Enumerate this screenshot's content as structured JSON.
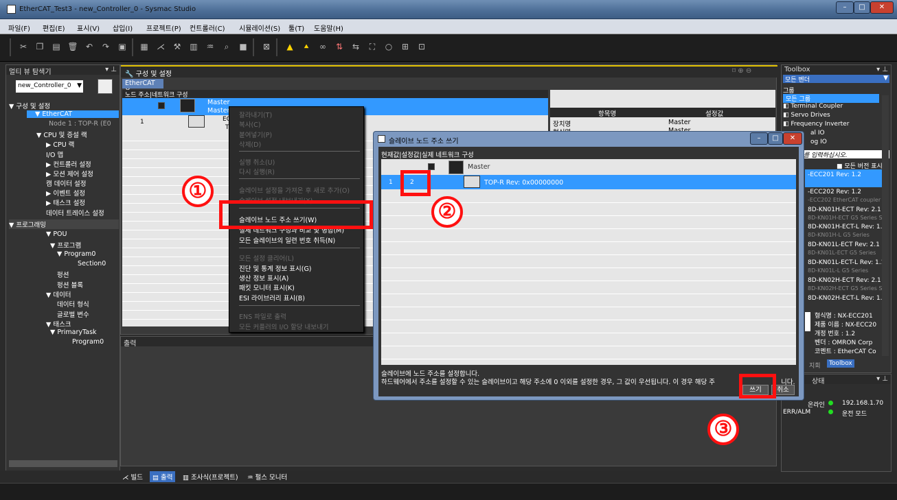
{
  "window": {
    "title": "EtherCAT_Test3 - new_Controller_0 - Sysmac Studio"
  },
  "menu": [
    "파일(F)",
    "편집(E)",
    "표시(V)",
    "삽입(I)",
    "프로젝트(P)",
    "컨트롤러(C)",
    "시뮬레이션(S)",
    "툴(T)",
    "도움말(H)"
  ],
  "multiview": {
    "title": "멀티 뷰 탐색기",
    "controller": "new_Controller_0",
    "tree": [
      "▼ 구성 및 설정",
      "▼ EtherCAT",
      "Node 1 : TOP-R (E0",
      "▼ CPU 및 증설 랙",
      "▶ CPU 랙",
      "I/O 맵",
      "▶ 컨트롤러 설정",
      "▶ 모션 제어 설정",
      "캠 데이터 설정",
      "▶ 이벤트 설정",
      "▶ 태스크 설정",
      "데이터 트레이스 설정",
      "▼ 프로그래밍",
      "▼ POU",
      "▼ 프로그램",
      "▼ Program0",
      "Section0",
      "펑션",
      "펑션 블록",
      "▼ 데이터",
      "데이터 형식",
      "글로벌 변수",
      "▼ 태스크",
      "▼ PrimaryTask",
      "Program0"
    ],
    "filter": "필터"
  },
  "config": {
    "title": "구성 및 설정",
    "tab": "EtherCAT",
    "grid_header": "노드 주소|네트워크 구성",
    "master": "Master",
    "master2": "Master",
    "node_addr": "1",
    "node_label": "EC",
    "node_label2": "T",
    "prop_headers": [
      "항목명",
      "설정값"
    ],
    "prop_rows": [
      [
        "장치명",
        "Master"
      ],
      [
        "형식명",
        "Master"
      ]
    ]
  },
  "context_menu": {
    "items": [
      {
        "label": "잘라내기(T)",
        "enabled": false
      },
      {
        "label": "복사(C)",
        "enabled": false
      },
      {
        "label": "붙여넣기(P)",
        "enabled": false
      },
      {
        "label": "삭제(D)",
        "enabled": false
      },
      {
        "label": "실행 취소(U)",
        "enabled": false
      },
      {
        "label": "다시 실행(R)",
        "enabled": false
      },
      {
        "label": "슬레이브 설정을 가져온 후 새로 추가(O)",
        "enabled": false
      },
      {
        "label": "슬레이브 설정 내보내기(X)",
        "enabled": false
      },
      {
        "label": "슬레이브 노드 주소 쓰기(W)",
        "enabled": true
      },
      {
        "label": "실제 네트워크 구성과 비교 및 병합(M)",
        "enabled": true
      },
      {
        "label": "모든 슬레이브의 일련 번호 취득(N)",
        "enabled": true
      },
      {
        "label": "모든 설정 클리어(L)",
        "enabled": false
      },
      {
        "label": "진단 및 통계 정보 표시(G)",
        "enabled": true
      },
      {
        "label": "생산 정보 표시(A)",
        "enabled": true
      },
      {
        "label": "패킷 모니터 표시(K)",
        "enabled": true
      },
      {
        "label": "ESI 라이브러리 표시(B)",
        "enabled": true
      },
      {
        "label": "ENS 파일로 출력",
        "enabled": false
      },
      {
        "label": "모든 커플러의 I/O 할당 내보내기",
        "enabled": false
      }
    ]
  },
  "dialog": {
    "title": "슬레이브 노드 주소 쓰기",
    "grid_header": "현재값|설정값|실제 네트워크 구성",
    "master": "Master",
    "row_current": "1",
    "row_set": "2",
    "node_label": "TOP-R Rev: 0x00000000",
    "msg1": "슬레이브에 노드 주소를 설정합니다.",
    "msg2": "하드웨어에서 주소를 설정할 수 있는 슬레이브이고 해당 주소에 0 이외를 설정한 경우, 그 값이 우선됩니다. 이 경우 해당 주",
    "msg2_tail": "니다.",
    "write_btn": "쓰기",
    "cancel_btn": "취소"
  },
  "output": {
    "title": "출력"
  },
  "bottom_tabs": [
    "빌드",
    "출력",
    "조사식(프로젝트)",
    "펄스 모니터"
  ],
  "toolbox": {
    "title": "Toolbox",
    "vendor": "모든 벤더",
    "group_label": "그룹",
    "groups": [
      "모든 그룹",
      "Terminal Coupler",
      "Servo Drives",
      "Frequency Inverter",
      "al IO",
      "og IO"
    ],
    "search_placeholder": "를 입력하십시오.",
    "all_versions": "■ 모든 버전 표시",
    "items": [
      {
        "name": "-ECC201 Rev: 1.2",
        "desc": ""
      },
      {
        "name": "-ECC202 Rev: 1.2",
        "desc": "-ECC202 EtherCAT coupler"
      },
      {
        "name": "8D-KN01H-ECT Rev: 2.1",
        "desc": "8D-KN01H-ECT G5 Series S"
      },
      {
        "name": "8D-KN01H-ECT-L Rev: 1.1",
        "desc": "8D-KN01H-L G5 Series"
      },
      {
        "name": "8D-KN01L-ECT Rev: 2.1",
        "desc": "8D-KN01L-ECT G5 Series"
      },
      {
        "name": "8D-KN01L-ECT-L Rev: 1.1",
        "desc": "8D-KN01L-L G5 Series"
      },
      {
        "name": "8D-KN02H-ECT Rev: 2.1",
        "desc": "8D-KN02H-ECT G5 Series S"
      },
      {
        "name": "8D-KN02H-ECT-L Rev: 1.1",
        "desc": ""
      }
    ],
    "info": [
      "형식명 : NX-ECC201",
      "제품 이름 : NX-ECC20",
      "개정 번호 : 1.2",
      "벤더 : OMRON Corp",
      "코멘트 : EtherCAT Co"
    ],
    "tabs": [
      "지회",
      "Toolbox"
    ]
  },
  "status_pane": {
    "title": "상태",
    "rows": [
      [
        "온라인",
        "192.168.1.70"
      ],
      [
        "ERR/ALM",
        "운전 모드"
      ]
    ]
  },
  "callouts": [
    "①",
    "②",
    "③"
  ],
  "colors": {
    "selection": "#3399ff",
    "highlight": "#ff1010",
    "online": "#22dd22"
  }
}
